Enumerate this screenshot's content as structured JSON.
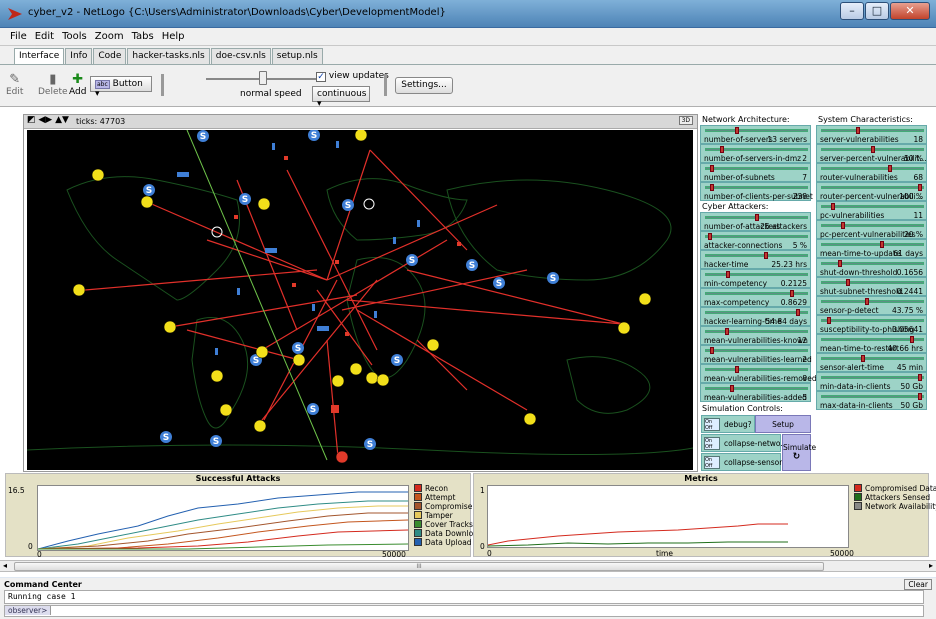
{
  "window": {
    "title": "cyber_v2 - NetLogo {C:\\Users\\Administrator\\Downloads\\Cyber\\DevelopmentModel}"
  },
  "menu": [
    "File",
    "Edit",
    "Tools",
    "Zoom",
    "Tabs",
    "Help"
  ],
  "tabs": [
    "Interface",
    "Info",
    "Code",
    "hacker-tasks.nls",
    "doe-csv.nls",
    "setup.nls"
  ],
  "toolbar": {
    "edit": "Edit",
    "delete": "Delete",
    "add": "Add",
    "widget_type": "Button",
    "speed_label": "normal speed",
    "view_updates": "view updates",
    "update_mode": "continuous",
    "settings": "Settings..."
  },
  "view": {
    "ticks": "ticks: 47703",
    "three_d": "3D"
  },
  "network": {
    "header": "Network Architecture:",
    "sliders": [
      {
        "name": "number-of-servers",
        "value": "13 servers",
        "pos": 0.3
      },
      {
        "name": "number-of-servers-in-dmz",
        "value": "2",
        "pos": 0.15
      },
      {
        "name": "number-of-subnets",
        "value": "7",
        "pos": 0.05
      },
      {
        "name": "number-of-clients-per-subnet",
        "value": "238",
        "pos": 0.05
      }
    ]
  },
  "attackers": {
    "header": "Cyber Attackers:",
    "sliders": [
      {
        "name": "number-of-attackers",
        "value": "25 attackers",
        "pos": 0.5
      },
      {
        "name": "attacker-connections",
        "value": "5 %",
        "pos": 0.03
      },
      {
        "name": "hacker-time",
        "value": "25.23 hrs",
        "pos": 0.6
      },
      {
        "name": "min-competency",
        "value": "0.2125",
        "pos": 0.21
      },
      {
        "name": "max-competency",
        "value": "0.8629",
        "pos": 0.86
      },
      {
        "name": "hacker-learning-time",
        "value": "54.84 days",
        "pos": 0.92
      },
      {
        "name": "mean-vulnerabilities-known",
        "value": "12",
        "pos": 0.2
      },
      {
        "name": "mean-vulnerabilities-learned",
        "value": "2",
        "pos": 0.05
      },
      {
        "name": "mean-vulnerabilities-removed",
        "value": "8",
        "pos": 0.3
      },
      {
        "name": "mean-vulnerabilities-added",
        "value": "5",
        "pos": 0.25
      }
    ]
  },
  "system": {
    "header": "System Characteristics:",
    "sliders": [
      {
        "name": "server-vulnerabilities",
        "value": "18",
        "pos": 0.35
      },
      {
        "name": "server-percent-vulnerabilit...",
        "value": "50 %",
        "pos": 0.5
      },
      {
        "name": "router-vulnerabilities",
        "value": "68",
        "pos": 0.68
      },
      {
        "name": "router-percent-vulnerabili...",
        "value": "100 %",
        "pos": 0.98
      },
      {
        "name": "pc-vulnerabilities",
        "value": "11",
        "pos": 0.1
      },
      {
        "name": "pc-percent-vulnerabilities",
        "value": "20 %",
        "pos": 0.2
      },
      {
        "name": "mean-time-to-update",
        "value": "61 days",
        "pos": 0.6
      },
      {
        "name": "shut-down-threshold",
        "value": "0.1656",
        "pos": 0.17
      },
      {
        "name": "shut-subnet-threshold",
        "value": "0.2441",
        "pos": 0.25
      },
      {
        "name": "sensor-p-detect",
        "value": "43.75 %",
        "pos": 0.44
      },
      {
        "name": "susceptibility-to-phishing",
        "value": "0.05641",
        "pos": 0.06
      },
      {
        "name": "mean-time-to-restart",
        "value": "40.66 hrs",
        "pos": 0.9
      },
      {
        "name": "sensor-alert-time",
        "value": "45 min",
        "pos": 0.4
      },
      {
        "name": "min-data-in-clients",
        "value": "50 Gb",
        "pos": 0.98
      },
      {
        "name": "max-data-in-clients",
        "value": "50 Gb",
        "pos": 0.98
      }
    ]
  },
  "controls": {
    "header": "Simulation Controls:",
    "switches": [
      "debug?",
      "collapse-netwo...",
      "collapse-sensors?"
    ],
    "switch_on": "On",
    "switch_off": "Off",
    "setup": "Setup",
    "simulate": "Simulate",
    "forever": "↻"
  },
  "attacks_plot": {
    "title": "Successful Attacks",
    "ymax": "16.5",
    "ymin": "0",
    "xmin": "0",
    "xmax": "50000",
    "legend": [
      {
        "label": "Recon",
        "color": "#d42a1e"
      },
      {
        "label": "Attempt",
        "color": "#c4561e"
      },
      {
        "label": "Compromise",
        "color": "#a3552c"
      },
      {
        "label": "Tamper",
        "color": "#e6c95c"
      },
      {
        "label": "Cover Tracks",
        "color": "#3a8c2f"
      },
      {
        "label": "Data Download",
        "color": "#2f8c86"
      },
      {
        "label": "Data Upload",
        "color": "#2360b0"
      }
    ]
  },
  "metrics_plot": {
    "title": "Metrics",
    "ymax": "1",
    "ymin": "0",
    "xmin": "0",
    "xmax": "50000",
    "xlabel": "time",
    "legend": [
      {
        "label": "Compromised Data",
        "color": "#d42a1e"
      },
      {
        "label": "Attackers Sensed",
        "color": "#1f6e1a"
      },
      {
        "label": "Network Availability",
        "color": "#888888"
      }
    ]
  },
  "scrollbar": {
    "grip": "III"
  },
  "command_center": {
    "title": "Command Center",
    "output": "Running case 1",
    "prompt": "observer>",
    "clear": "Clear"
  }
}
